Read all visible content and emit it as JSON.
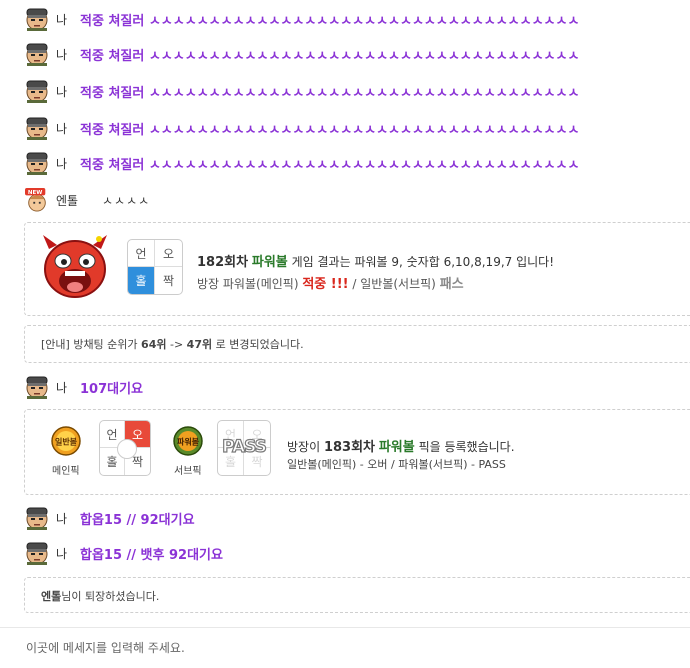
{
  "chat": {
    "messages": [
      {
        "nick": "나",
        "text": "적중 쳐질러 ㅅㅅㅅㅅㅅㅅㅅㅅㅅㅅㅅㅅㅅㅅㅅㅅㅅㅅㅅㅅㅅㅅㅅㅅㅅㅅㅅㅅㅅㅅㅅㅅㅅㅅㅅㅅ"
      },
      {
        "nick": "나",
        "text": "적중 쳐질러 ㅅㅅㅅㅅㅅㅅㅅㅅㅅㅅㅅㅅㅅㅅㅅㅅㅅㅅㅅㅅㅅㅅㅅㅅㅅㅅㅅㅅㅅㅅㅅㅅㅅㅅㅅㅅ"
      },
      {
        "nick": "나",
        "text": "적중 쳐질러 ㅅㅅㅅㅅㅅㅅㅅㅅㅅㅅㅅㅅㅅㅅㅅㅅㅅㅅㅅㅅㅅㅅㅅㅅㅅㅅㅅㅅㅅㅅㅅㅅㅅㅅㅅㅅ"
      },
      {
        "nick": "나",
        "text": "적중 쳐질러 ㅅㅅㅅㅅㅅㅅㅅㅅㅅㅅㅅㅅㅅㅅㅅㅅㅅㅅㅅㅅㅅㅅㅅㅅㅅㅅㅅㅅㅅㅅㅅㅅㅅㅅㅅㅅ"
      },
      {
        "nick": "나",
        "text": "적중 쳐질러 ㅅㅅㅅㅅㅅㅅㅅㅅㅅㅅㅅㅅㅅㅅㅅㅅㅅㅅㅅㅅㅅㅅㅅㅅㅅㅅㅅㅅㅅㅅㅅㅅㅅㅅㅅㅅ"
      },
      {
        "nick": "엔톨",
        "text": "ㅅㅅㅅㅅ"
      },
      {
        "nick": "나",
        "text": "107대기요"
      },
      {
        "nick": "나",
        "text": "합옵15 // 92대기요"
      },
      {
        "nick": "나",
        "text": "합옵15 // 뱃후 92대기요"
      }
    ],
    "new_badge": "NEW",
    "result": {
      "round": "182회차",
      "game": "파워볼",
      "text_mid": "게임 결과는 파워볼 9, 숫자합 6,10,8,19,7 입니다!",
      "line2_prefix": "방장 파워볼(메인픽)",
      "hit": "적중 !!!",
      "line2_mid": "/ 일반볼(서브픽)",
      "pass": "패스",
      "grid": [
        "언",
        "오",
        "홀",
        "짝"
      ]
    },
    "notice": {
      "prefix": "[안내] 방채팅 순위가",
      "from": "64위",
      "arrow": "->",
      "to": "47위",
      "suffix": "로 변경되었습니다."
    },
    "pick": {
      "main_ball": "일반볼",
      "main_label": "메인픽",
      "sub_ball": "파워볼",
      "sub_label": "서브픽",
      "grid": [
        "언",
        "오",
        "홀",
        "짝"
      ],
      "pass_text": "PASS",
      "line1_prefix": "방장이",
      "round": "183회차",
      "game": "파워볼",
      "line1_suffix": "픽을 등록했습니다.",
      "line2": "일반볼(메인픽) - 오버 / 파워볼(서브픽) - PASS"
    },
    "leave": {
      "name": "엔톨",
      "text": "님이 퇴장하셨습니다."
    }
  },
  "input": {
    "placeholder": "이곳에 메세지를 입력해 주세요."
  },
  "colors": {
    "purple": "#8b33d6",
    "green": "#2a7a2a",
    "red": "#d9261c",
    "blue": "#2f8fdc"
  }
}
